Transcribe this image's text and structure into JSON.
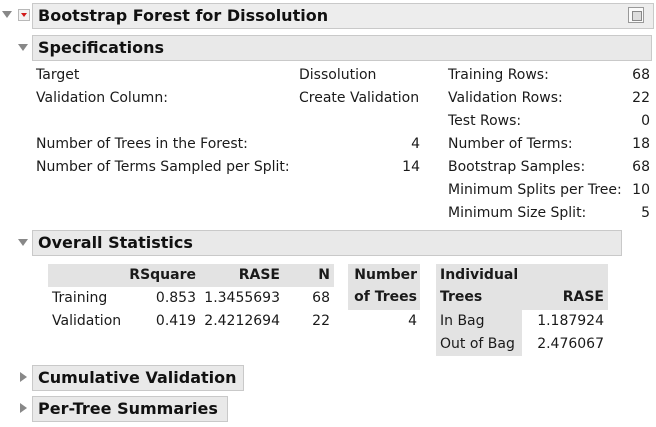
{
  "report": {
    "title": "Bootstrap Forest for Dissolution"
  },
  "specifications": {
    "title": "Specifications",
    "target_label": "Target",
    "target_value": "Dissolution",
    "validation_label": "Validation Column:",
    "validation_value": "Create Validation",
    "trees_label": "Number of Trees in the Forest:",
    "trees_value": "4",
    "terms_sampled_label": "Number of Terms Sampled per Split:",
    "terms_sampled_value": "14",
    "right": [
      {
        "label": "Training Rows:",
        "value": "68"
      },
      {
        "label": "Validation Rows:",
        "value": "22"
      },
      {
        "label": "Test Rows:",
        "value": "0"
      },
      {
        "label": "Number of Terms:",
        "value": "18"
      },
      {
        "label": "Bootstrap Samples:",
        "value": "68"
      },
      {
        "label": "Minimum Splits per Tree:",
        "value": "10"
      },
      {
        "label": "Minimum Size Split:",
        "value": "5"
      }
    ]
  },
  "overall": {
    "title": "Overall Statistics",
    "headers": [
      "RSquare",
      "RASE",
      "N"
    ],
    "rows": [
      {
        "label": "Training",
        "rsquare": "0.853",
        "rase": "1.3455693",
        "n": "68"
      },
      {
        "label": "Validation",
        "rsquare": "0.419",
        "rase": "2.4212694",
        "n": "22"
      }
    ],
    "trees_header_1": "Number",
    "trees_header_2": "of Trees",
    "trees_value": "4",
    "indiv_header_1": "Individual",
    "indiv_header_2": "Trees",
    "indiv_rase_header": "RASE",
    "indiv_rows": [
      {
        "label": "In Bag",
        "value": "1.187924"
      },
      {
        "label": "Out of Bag",
        "value": "2.476067"
      }
    ]
  },
  "cumulative": {
    "title": "Cumulative Validation"
  },
  "pertree": {
    "title": "Per-Tree Summaries"
  }
}
